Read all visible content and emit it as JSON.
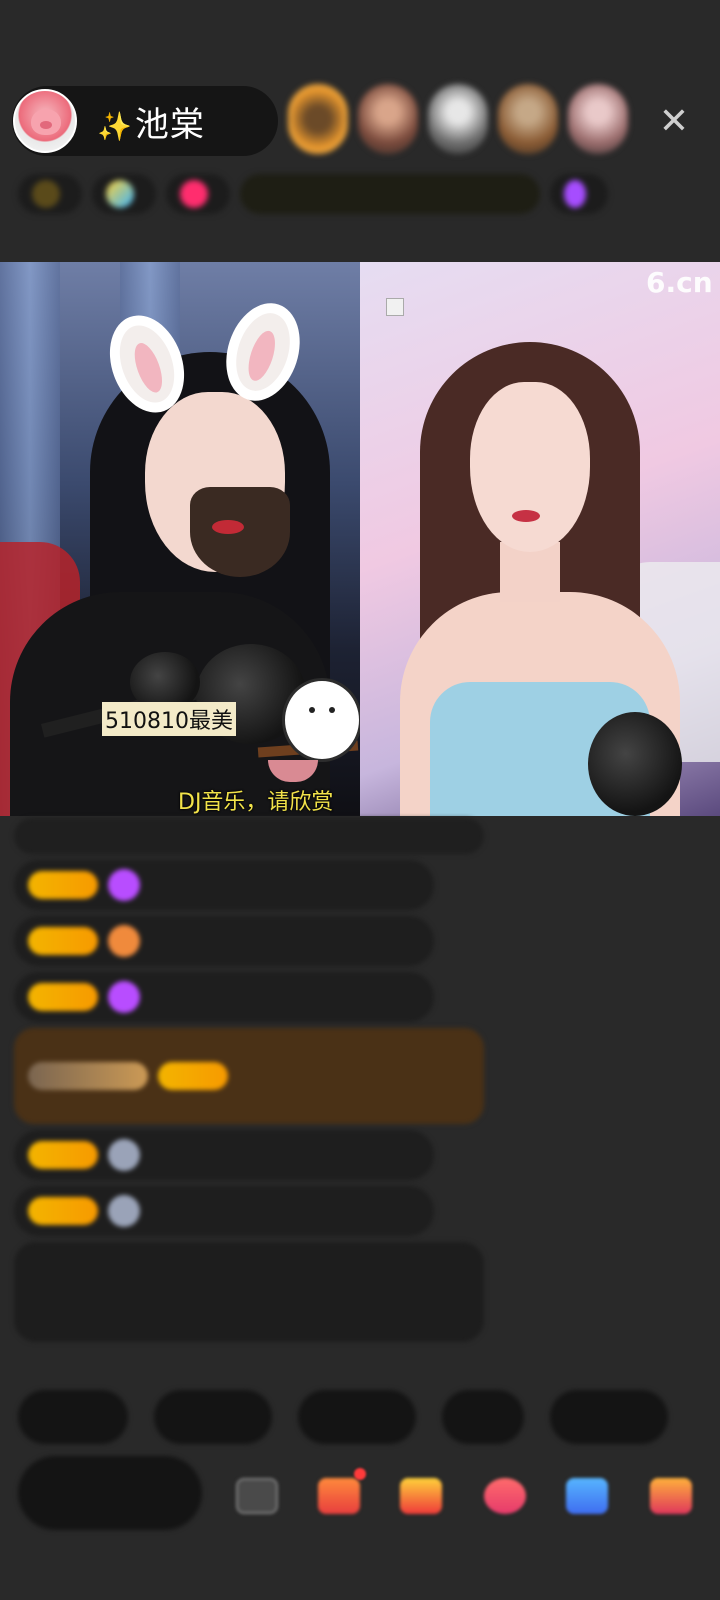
{
  "host": {
    "sparkle": "✨",
    "name": "池棠"
  },
  "viewers": {
    "count_visible": 5
  },
  "close_symbol": "✕",
  "info_row": {
    "chips": [
      "",
      "",
      "",
      "",
      ""
    ]
  },
  "video": {
    "watermark": "6.cn",
    "left_caption": "510810最美",
    "dj_caption": "DJ音乐，请欣赏"
  },
  "chat": {
    "messages": [
      "",
      "",
      "",
      "",
      "",
      "",
      "",
      ""
    ]
  },
  "quick_phrases": [
    "",
    "",
    "",
    "",
    "",
    ""
  ],
  "toolbar": {
    "input_placeholder": ""
  },
  "colors": {
    "background": "#292929",
    "accent_gold": "#f3b400",
    "pill": "#151515"
  }
}
